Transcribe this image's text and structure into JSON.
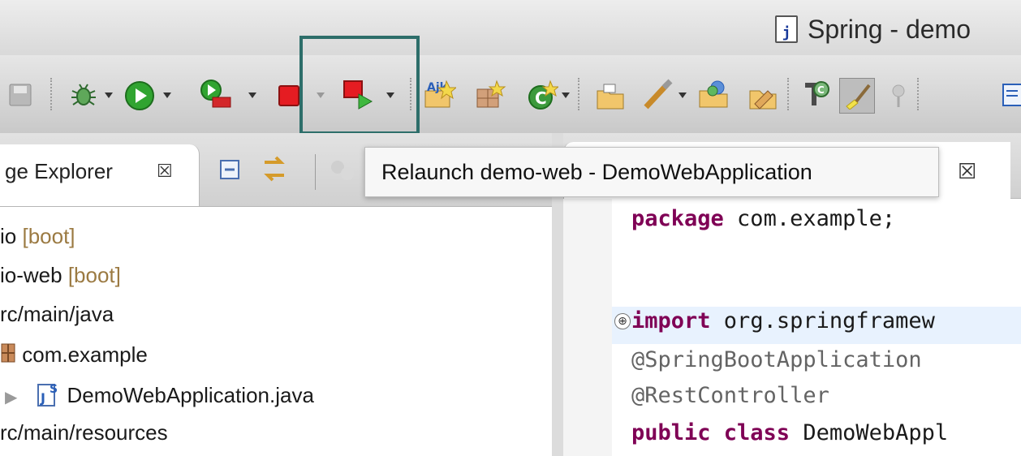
{
  "window": {
    "title": "Spring - demo",
    "title_icon": "java-file-icon"
  },
  "toolbar": {
    "icons": [
      "save-icon",
      "debug-icon",
      "run-icon",
      "coverage-icon",
      "stop-icon",
      "relaunch-icon",
      "new-java-project-icon",
      "new-package-icon",
      "new-class-icon",
      "open-type-icon",
      "search-icon",
      "open-task-icon",
      "open-perspective-icon",
      "breakpoint-icon",
      "highlight-brush-icon",
      "toggle-icon",
      "outline-icon"
    ],
    "highlight_color": "#2d6e6a"
  },
  "tooltip": {
    "text": "Relaunch demo-web - DemoWebApplication"
  },
  "package_explorer": {
    "tab_title": "ge Explorer",
    "tab_close": "☒",
    "items": [
      {
        "label": "io",
        "decoration": "[boot]"
      },
      {
        "label": "io-web",
        "decoration": "[boot]"
      },
      {
        "label": "rc/main/java",
        "decoration": ""
      },
      {
        "label": "com.example",
        "decoration": ""
      },
      {
        "label": "DemoWebApplication.java",
        "decoration": ""
      },
      {
        "label": "rc/main/resources",
        "decoration": ""
      }
    ]
  },
  "editor": {
    "tab_close": "☒",
    "fold_symbol": "⊕",
    "lines": [
      {
        "keyword": "package",
        "rest": " com.example;"
      },
      {
        "keyword": "import",
        "rest": " org.springframew"
      },
      {
        "annotation": "@SpringBootApplication"
      },
      {
        "annotation": "@RestController"
      },
      {
        "keyword": "public class",
        "rest": " DemoWebAppl"
      }
    ]
  }
}
